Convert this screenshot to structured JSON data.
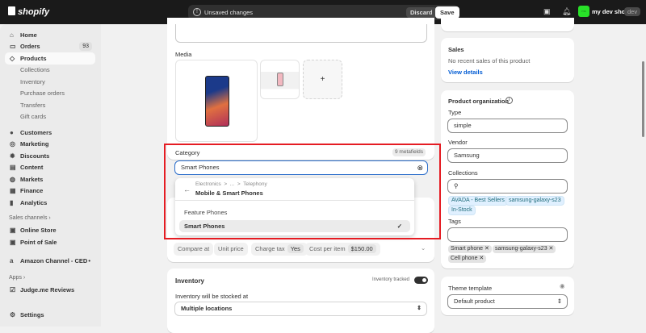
{
  "topbar": {
    "brand": "shopify",
    "unsaved": "Unsaved changes",
    "discard": "Discard",
    "save": "Save",
    "avatar": "ms",
    "shop_name": "my dev shop",
    "shop_badge": "dev"
  },
  "sidebar": {
    "items": [
      {
        "label": "Home",
        "icon": "home-icon"
      },
      {
        "label": "Orders",
        "icon": "inbox-icon",
        "count": "93"
      },
      {
        "label": "Products",
        "icon": "tag-icon"
      },
      {
        "label": "Collections"
      },
      {
        "label": "Inventory"
      },
      {
        "label": "Purchase orders"
      },
      {
        "label": "Transfers"
      },
      {
        "label": "Gift cards"
      },
      {
        "label": "Customers",
        "icon": "person-icon"
      },
      {
        "label": "Marketing",
        "icon": "target-icon"
      },
      {
        "label": "Discounts",
        "icon": "discount-icon"
      },
      {
        "label": "Content",
        "icon": "content-icon"
      },
      {
        "label": "Markets",
        "icon": "globe-icon"
      },
      {
        "label": "Finance",
        "icon": "bank-icon"
      },
      {
        "label": "Analytics",
        "icon": "chart-icon"
      }
    ],
    "sales_channels": "Sales channels ›",
    "channels": [
      {
        "label": "Online Store"
      },
      {
        "label": "Point of Sale"
      },
      {
        "label": "Amazon Channel - CED"
      }
    ],
    "apps": "Apps ›",
    "app_items": [
      {
        "label": "Judge.me Reviews"
      }
    ],
    "settings": "Settings"
  },
  "main": {
    "media_label": "Media",
    "add_media": "+",
    "category": {
      "label": "Category",
      "metafields": "9 metafields",
      "value": "Smart Phones",
      "dropdown": {
        "breadcrumb": "Electronics  >  ...  >  Telephony",
        "current": "Mobile & Smart Phones",
        "options": [
          "Feature Phones",
          "Smart Phones"
        ],
        "selected": "Smart Phones"
      }
    },
    "pricing": {
      "compare_at": "Compare at",
      "unit_price": "Unit price",
      "charge_tax": "Charge tax",
      "charge_tax_value": "Yes",
      "cost_per_item": "Cost per item",
      "cost_value": "$150.00"
    },
    "inventory": {
      "title": "Inventory",
      "tracked_label": "Inventory tracked",
      "tracked": true,
      "stocked_label": "Inventory will be stocked at",
      "location": "Multiple locations"
    }
  },
  "right": {
    "sales": {
      "title": "Sales",
      "text": "No recent sales of this product",
      "link": "View details"
    },
    "org": {
      "title": "Product organization",
      "type_label": "Type",
      "type": "simple",
      "vendor_label": "Vendor",
      "vendor": "Samsung",
      "collections_label": "Collections",
      "collections": [
        "AVADA - Best Sellers",
        "samsung-galaxy-s23",
        "In-Stock"
      ],
      "tags_label": "Tags",
      "tags": [
        "Smart phone",
        "samsung-galaxy-s23",
        "Cell phone"
      ]
    },
    "theme": {
      "title": "Theme template",
      "value": "Default product"
    }
  },
  "colors": {
    "highlight": "#e51c23",
    "link": "#005bd3",
    "focus": "#2c6ecb"
  }
}
